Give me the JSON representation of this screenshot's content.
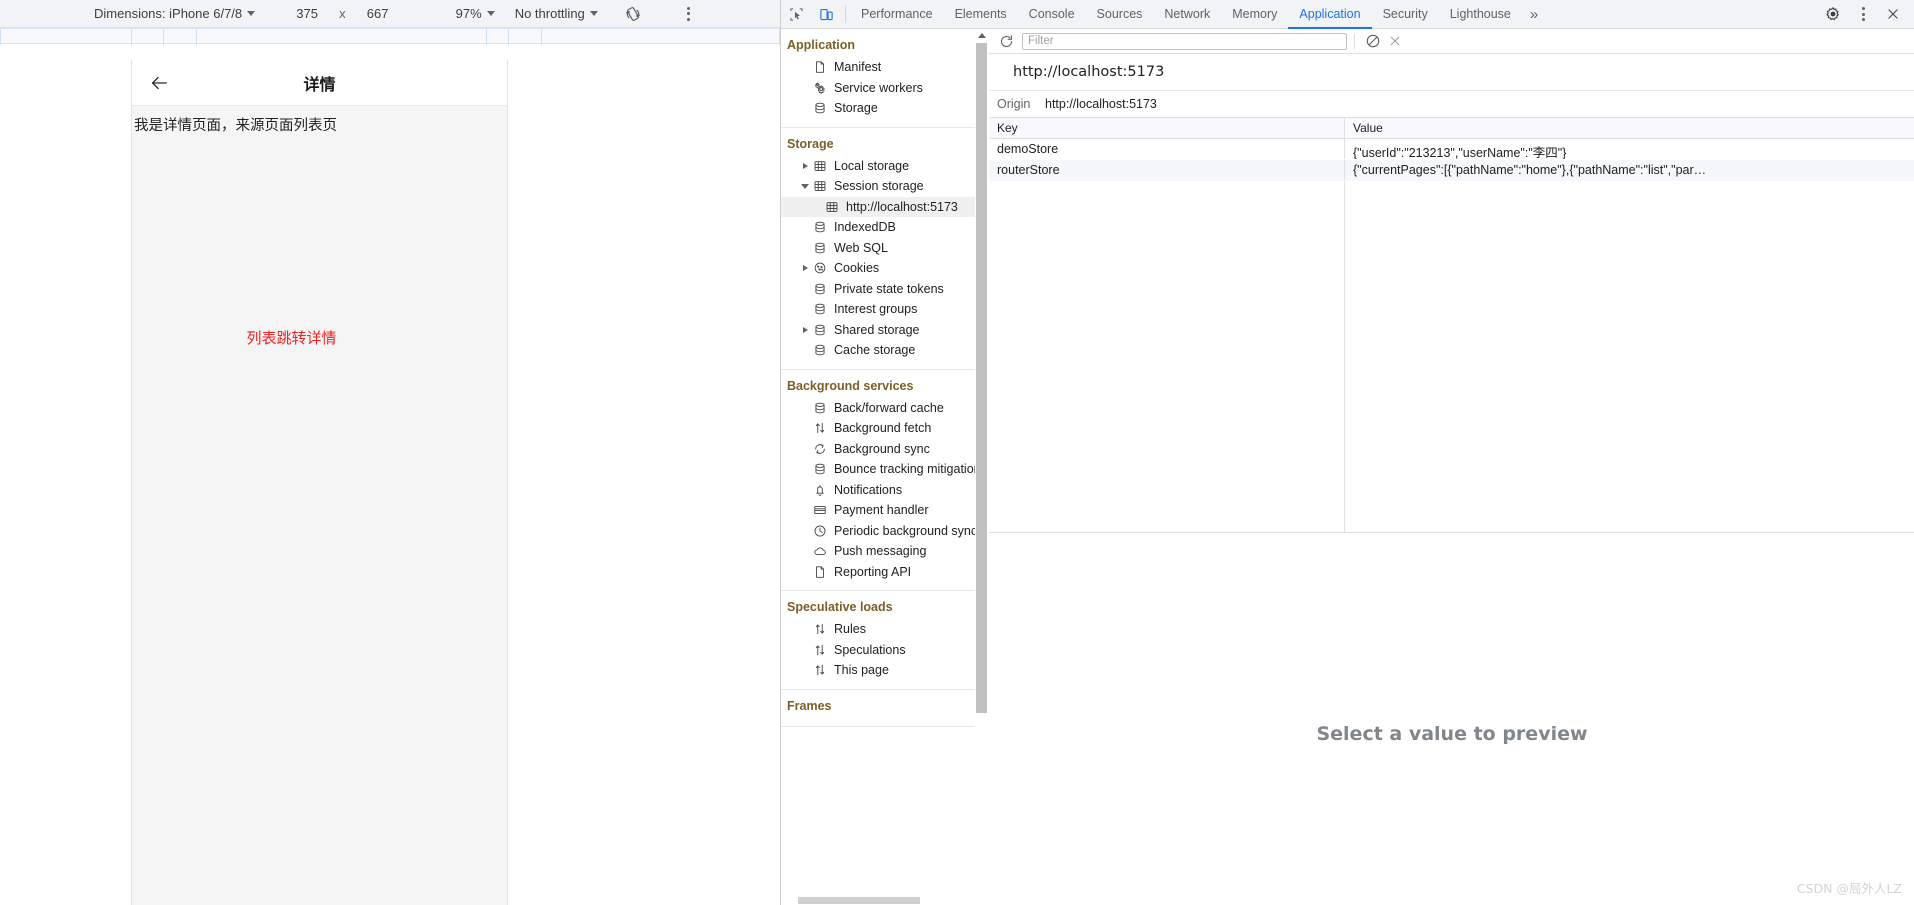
{
  "device_toolbar": {
    "dimensions_label": "Dimensions: iPhone 6/7/8",
    "width_value": "375",
    "times_symbol": "x",
    "height_value": "667",
    "zoom_label": "97%",
    "throttling_label": "No throttling",
    "rotate_icon": "rotate-device-icon",
    "more_icon": "more-options-icon"
  },
  "device_page": {
    "back_icon": "back-arrow-icon",
    "title": "详情",
    "body_text": "我是详情页面，来源页面列表页",
    "link_text": "列表跳转详情",
    "link_color": "#ee2222"
  },
  "devtools": {
    "inspect_icon": "inspect-element-icon",
    "device_toggle_icon": "device-toolbar-icon",
    "tabs": [
      {
        "label": "Performance",
        "active": false
      },
      {
        "label": "Elements",
        "active": false
      },
      {
        "label": "Console",
        "active": false
      },
      {
        "label": "Sources",
        "active": false
      },
      {
        "label": "Network",
        "active": false
      },
      {
        "label": "Memory",
        "active": false
      },
      {
        "label": "Application",
        "active": true
      },
      {
        "label": "Security",
        "active": false
      },
      {
        "label": "Lighthouse",
        "active": false
      }
    ],
    "more_tabs_label": "»",
    "settings_icon": "gear-icon",
    "kebab_icon": "more-options-icon",
    "close_icon": "close-icon",
    "accent_color": "#1a73e8"
  },
  "sidebar": {
    "sections": [
      {
        "title": "Application",
        "items": [
          {
            "label": "Manifest",
            "icon": "document-icon",
            "indent": 1,
            "arrow": "none",
            "selected": false
          },
          {
            "label": "Service workers",
            "icon": "gears-icon",
            "indent": 1,
            "arrow": "none",
            "selected": false
          },
          {
            "label": "Storage",
            "icon": "database-icon",
            "indent": 1,
            "arrow": "none",
            "selected": false
          }
        ]
      },
      {
        "title": "Storage",
        "items": [
          {
            "label": "Local storage",
            "icon": "table-icon",
            "indent": 1,
            "arrow": "closed",
            "selected": false
          },
          {
            "label": "Session storage",
            "icon": "table-icon",
            "indent": 1,
            "arrow": "open",
            "selected": false
          },
          {
            "label": "http://localhost:5173",
            "icon": "table-icon",
            "indent": 2,
            "arrow": "none",
            "selected": true
          },
          {
            "label": "IndexedDB",
            "icon": "database-icon",
            "indent": 1,
            "arrow": "none",
            "selected": false
          },
          {
            "label": "Web SQL",
            "icon": "database-icon",
            "indent": 1,
            "arrow": "none",
            "selected": false
          },
          {
            "label": "Cookies",
            "icon": "cookie-icon",
            "indent": 1,
            "arrow": "closed",
            "selected": false
          },
          {
            "label": "Private state tokens",
            "icon": "database-icon",
            "indent": 1,
            "arrow": "none",
            "selected": false
          },
          {
            "label": "Interest groups",
            "icon": "database-icon",
            "indent": 1,
            "arrow": "none",
            "selected": false
          },
          {
            "label": "Shared storage",
            "icon": "database-icon",
            "indent": 1,
            "arrow": "closed",
            "selected": false
          },
          {
            "label": "Cache storage",
            "icon": "database-icon",
            "indent": 1,
            "arrow": "none",
            "selected": false
          }
        ]
      },
      {
        "title": "Background services",
        "items": [
          {
            "label": "Back/forward cache",
            "icon": "database-icon",
            "indent": 1,
            "arrow": "none",
            "selected": false
          },
          {
            "label": "Background fetch",
            "icon": "updown-arrows-icon",
            "indent": 1,
            "arrow": "none",
            "selected": false
          },
          {
            "label": "Background sync",
            "icon": "sync-icon",
            "indent": 1,
            "arrow": "none",
            "selected": false
          },
          {
            "label": "Bounce tracking mitigations",
            "icon": "database-icon",
            "indent": 1,
            "arrow": "none",
            "selected": false
          },
          {
            "label": "Notifications",
            "icon": "bell-icon",
            "indent": 1,
            "arrow": "none",
            "selected": false
          },
          {
            "label": "Payment handler",
            "icon": "credit-card-icon",
            "indent": 1,
            "arrow": "none",
            "selected": false
          },
          {
            "label": "Periodic background sync",
            "icon": "clock-icon",
            "indent": 1,
            "arrow": "none",
            "selected": false
          },
          {
            "label": "Push messaging",
            "icon": "cloud-icon",
            "indent": 1,
            "arrow": "none",
            "selected": false
          },
          {
            "label": "Reporting API",
            "icon": "document-icon",
            "indent": 1,
            "arrow": "none",
            "selected": false
          }
        ]
      },
      {
        "title": "Speculative loads",
        "items": [
          {
            "label": "Rules",
            "icon": "updown-arrows-icon",
            "indent": 1,
            "arrow": "none",
            "selected": false
          },
          {
            "label": "Speculations",
            "icon": "updown-arrows-icon",
            "indent": 1,
            "arrow": "none",
            "selected": false
          },
          {
            "label": "This page",
            "icon": "updown-arrows-icon",
            "indent": 1,
            "arrow": "none",
            "selected": false
          }
        ]
      },
      {
        "title": "Frames",
        "items": []
      }
    ]
  },
  "main": {
    "refresh_icon": "refresh-icon",
    "filter_placeholder": "Filter",
    "filter_value": "",
    "clear_icon": "clear-all-icon",
    "delete_icon": "delete-selected-icon",
    "origin_title": "http://localhost:5173",
    "origin_label": "Origin",
    "origin_value": "http://localhost:5173",
    "columns": [
      "Key",
      "Value"
    ],
    "rows": [
      {
        "key": "demoStore",
        "value": "{\"userId\":\"213213\",\"userName\":\"李四\"}"
      },
      {
        "key": "routerStore",
        "value": "{\"currentPages\":[{\"pathName\":\"home\"},{\"pathName\":\"list\",\"par…"
      }
    ],
    "preview_placeholder": "Select a value to preview"
  },
  "watermark": "CSDN @局外人LZ"
}
